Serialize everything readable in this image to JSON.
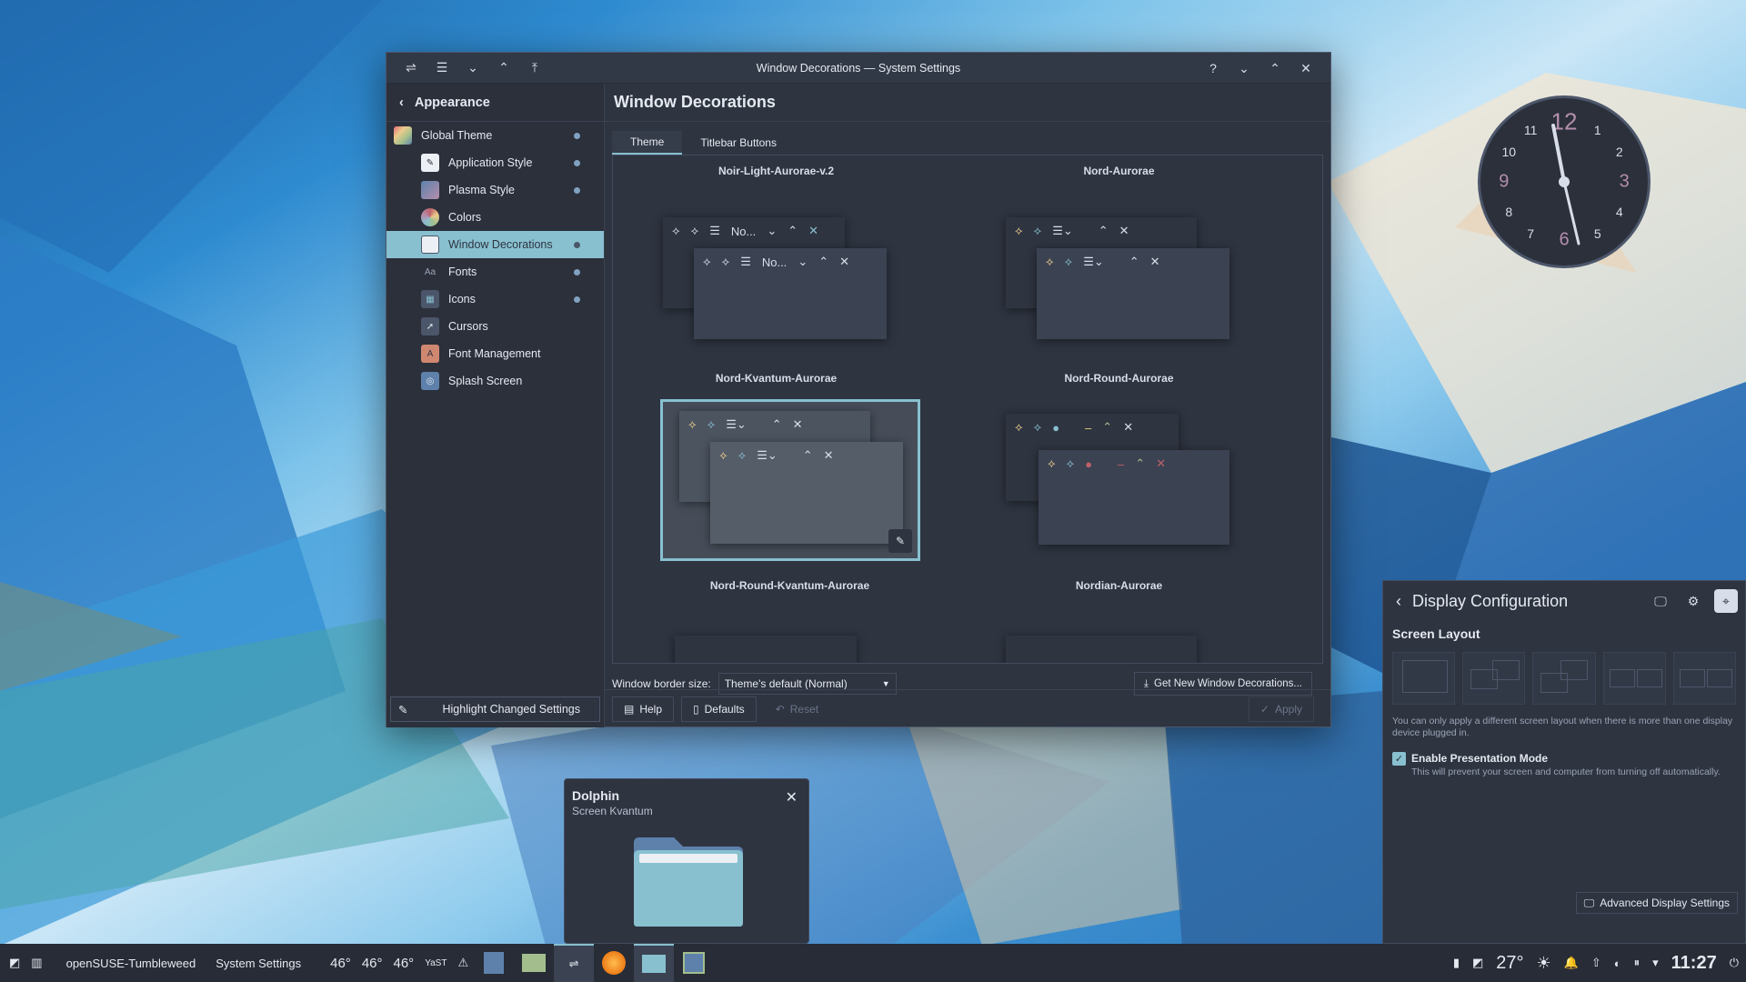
{
  "window": {
    "title": "Window Decorations — System Settings",
    "help_icon": "?",
    "sidebar": {
      "back_label": "Appearance",
      "items": [
        {
          "label": "Global Theme",
          "icon": "global-theme-icon",
          "color": "#e06c75"
        },
        {
          "label": "Application Style",
          "icon": "application-style-icon",
          "color": "#eceff4"
        },
        {
          "label": "Plasma Style",
          "icon": "plasma-style-icon",
          "color": "#5e81ac"
        },
        {
          "label": "Colors",
          "icon": "colors-icon",
          "color": "#d08770"
        },
        {
          "label": "Window Decorations",
          "icon": "window-decorations-icon",
          "color": "#eceff4"
        },
        {
          "label": "Fonts",
          "icon": "fonts-icon",
          "color": "#4c566a"
        },
        {
          "label": "Icons",
          "icon": "icons-icon",
          "color": "#5e81ac"
        },
        {
          "label": "Cursors",
          "icon": "cursors-icon",
          "color": "#4c566a"
        },
        {
          "label": "Font Management",
          "icon": "font-management-icon",
          "color": "#d08770"
        },
        {
          "label": "Splash Screen",
          "icon": "splash-screen-icon",
          "color": "#5e81ac"
        }
      ],
      "highlight_button": "Highlight Changed Settings"
    },
    "page_title": "Window Decorations",
    "tabs": [
      {
        "label": "Theme"
      },
      {
        "label": "Titlebar Buttons"
      }
    ],
    "themes": {
      "top_row": [
        "Noir-Light-Aurorae-v.2",
        "Nord-Aurorae"
      ],
      "row1": [
        "Nord-Kvantum-Aurorae",
        "Nord-Round-Aurorae"
      ],
      "row2": [
        "Nord-Round-Kvantum-Aurorae",
        "Nordian-Aurorae"
      ],
      "preview_title_short": "No...",
      "selected": "Nord-Round-Kvantum-Aurorae"
    },
    "border_size_label": "Window border size:",
    "border_size_value": "Theme's default (Normal)",
    "get_new_label": "Get New Window Decorations...",
    "footer": {
      "help": "Help",
      "defaults": "Defaults",
      "reset": "Reset",
      "apply": "Apply"
    }
  },
  "clock": {
    "numbers": [
      "12",
      "1",
      "2",
      "3",
      "4",
      "5",
      "6",
      "7",
      "8",
      "9",
      "10",
      "11"
    ]
  },
  "display_panel": {
    "title": "Display Configuration",
    "section": "Screen Layout",
    "note": "You can only apply a different screen layout when there is more than one display device plugged in.",
    "presentation_label": "Enable Presentation Mode",
    "presentation_desc": "This will prevent your screen and computer from turning off automatically.",
    "advanced_label": "Advanced Display Settings"
  },
  "dolphin_tooltip": {
    "title": "Dolphin",
    "subtitle": "Screen Kvantum"
  },
  "taskbar": {
    "distro": "openSUSE-Tumbleweed",
    "active_app": "System Settings",
    "temps": [
      "46°",
      "46°",
      "46°"
    ],
    "yast": "YaST",
    "weather": "27°",
    "time": "11:27"
  }
}
